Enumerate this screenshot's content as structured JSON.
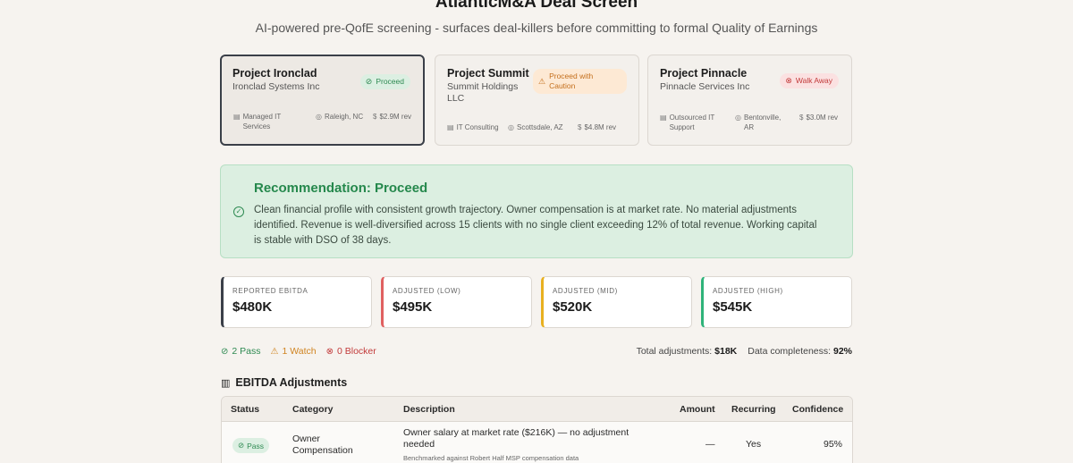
{
  "header": {
    "title": "AtlanticM&A Deal Screen",
    "subtitle": "AI-powered pre-QofE screening - surfaces deal-killers before committing to formal Quality of Earnings"
  },
  "deals": [
    {
      "name": "Project Ironclad",
      "company": "Ironclad Systems Inc",
      "badge": "Proceed",
      "industry": "Managed IT Services",
      "location": "Raleigh, NC",
      "revenue": "$2.9M rev"
    },
    {
      "name": "Project Summit",
      "company": "Summit Holdings LLC",
      "badge": "Proceed with Caution",
      "industry": "IT Consulting",
      "location": "Scottsdale, AZ",
      "revenue": "$4.8M rev"
    },
    {
      "name": "Project Pinnacle",
      "company": "Pinnacle Services Inc",
      "badge": "Walk Away",
      "industry": "Outsourced IT Support",
      "location": "Bentonville, AR",
      "revenue": "$3.0M rev"
    }
  ],
  "recommendation": {
    "title": "Recommendation: Proceed",
    "body": "Clean financial profile with consistent growth trajectory. Owner compensation is at market rate. No material adjustments identified. Revenue is well-diversified across 15 clients with no single client exceeding 12% of total revenue. Working capital is stable with DSO of 38 days."
  },
  "metrics": [
    {
      "label": "REPORTED EBITDA",
      "value": "$480K",
      "accent": "#3a3f48"
    },
    {
      "label": "ADJUSTED (LOW)",
      "value": "$495K",
      "accent": "#e06060"
    },
    {
      "label": "ADJUSTED (MID)",
      "value": "$520K",
      "accent": "#e8b020"
    },
    {
      "label": "ADJUSTED (HIGH)",
      "value": "$545K",
      "accent": "#2fb37a"
    }
  ],
  "summary": {
    "pass": "2 Pass",
    "watch": "1 Watch",
    "blocker": "0 Blocker",
    "total_label": "Total adjustments:",
    "total_value": "$18K",
    "completeness_label": "Data completeness:",
    "completeness_value": "92%"
  },
  "adjustments": {
    "title": "EBITDA Adjustments",
    "columns": [
      "Status",
      "Category",
      "Description",
      "Amount",
      "Recurring",
      "Confidence"
    ],
    "rows": [
      {
        "status": "Pass",
        "category": "Owner Compensation",
        "description": "Owner salary at market rate ($216K) — no adjustment needed",
        "note": "Benchmarked against Robert Half MSP compensation data",
        "amount": "—",
        "recurring": "Yes",
        "confidence": "95%"
      }
    ]
  },
  "colors": {
    "proceed": "#2e8a52",
    "caution": "#c46f1c",
    "walk_away": "#c23a3a"
  }
}
